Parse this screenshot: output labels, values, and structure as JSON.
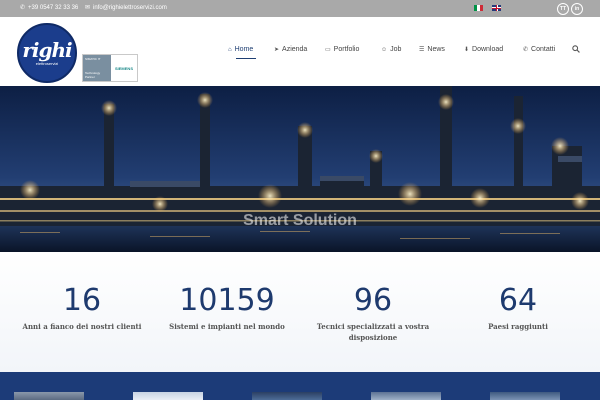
{
  "topbar": {
    "phone": "+39 0547 32 33 36",
    "email": "info@righielettroservizi.com",
    "languages": [
      "it",
      "en"
    ],
    "social": [
      "TT",
      "in"
    ]
  },
  "brand": {
    "logo_word": "righi",
    "logo_sub": "elettroservizi",
    "partner_left_top": "SIMATIC IT",
    "partner_left_bottom": "Technology Partner",
    "partner_right": "SIEMENS"
  },
  "nav": {
    "items": [
      {
        "label": "Home",
        "icon": "home-icon",
        "active": true
      },
      {
        "label": "Azienda",
        "icon": "paper-plane-icon"
      },
      {
        "label": "Portfolio",
        "icon": "folder-icon"
      },
      {
        "label": "Job",
        "icon": "users-icon"
      },
      {
        "label": "News",
        "icon": "sitemap-icon"
      },
      {
        "label": "Download",
        "icon": "download-icon"
      },
      {
        "label": "Contatti",
        "icon": "phone-icon"
      }
    ],
    "search_icon": "search-icon"
  },
  "hero": {
    "title": "Smart Solution"
  },
  "stats": [
    {
      "value": "16",
      "label": "Anni a fianco dei nostri clienti"
    },
    {
      "value": "10159",
      "label": "Sistemi e impianti nel mondo"
    },
    {
      "value": "96",
      "label": "Tecnici specializzati a vostra disposizione"
    },
    {
      "value": "64",
      "label": "Paesi raggiunti"
    }
  ],
  "colors": {
    "topbar": "#a9a9a9",
    "brand_blue": "#1e3e72",
    "band": "#1c3b78"
  }
}
